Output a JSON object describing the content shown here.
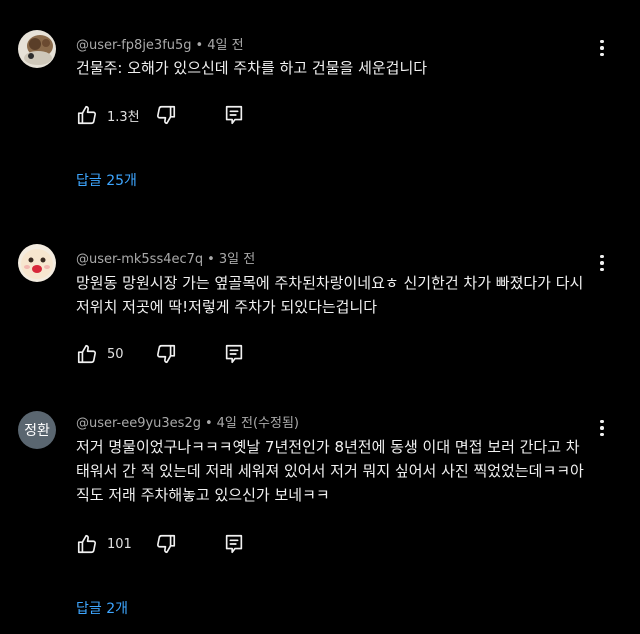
{
  "comments": [
    {
      "author": "@user-fp8je3fu5g",
      "separator": "•",
      "time": "4일 전",
      "text": "건물주: 오해가 있으신데 주차를 하고 건물을 세운겁니다",
      "likes": "1.3천",
      "replies_label": "답글 25개",
      "avatar": "photo"
    },
    {
      "author": "@user-mk5ss4ec7q",
      "separator": "•",
      "time": "3일 전",
      "text": "망원동 망원시장 가는 옆골목에 주차된차랑이네요ㅎ 신기한건 차가 빠졌다가 다시 저위치 저곳에 딱!저렇게 주차가 되있다는겁니다",
      "likes": "50",
      "avatar": "photo"
    },
    {
      "author": "@user-ee9yu3es2g",
      "separator": "•",
      "time": "4일 전(수정됨)",
      "text": "저거 명물이었구나ㅋㅋㅋ옛날 7년전인가 8년전에 동생 이대 면접 보러 간다고 차 태워서 간 적 있는데 저래 세워져 있어서 저거 뭐지 싶어서 사진 찍었었는데ㅋㅋ아직도 저래 주차해놓고 있으신가 보네ㅋㅋ",
      "likes": "101",
      "replies_label": "답글 2개",
      "avatar": "initials",
      "avatar_initials": "정환"
    }
  ],
  "icons": {
    "like": "thumbs-up-icon",
    "dislike": "thumbs-down-icon",
    "reply": "reply-icon",
    "more": "more-vert-icon"
  },
  "colors": {
    "background": "#000000",
    "text": "#f1f1f1",
    "meta": "#aaaaaa",
    "link": "#3ea6ff",
    "avatar_initials_bg": "#5a6670"
  }
}
